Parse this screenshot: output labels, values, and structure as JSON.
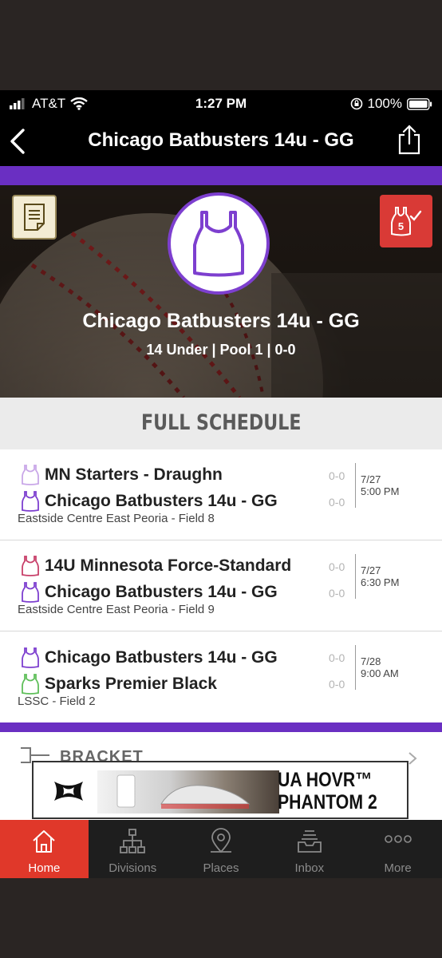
{
  "status_bar": {
    "carrier": "AT&T",
    "time": "1:27 PM",
    "battery": "100%"
  },
  "nav": {
    "title": "Chicago Batbusters 14u - GG",
    "back_icon": "chevron-left-icon",
    "share_icon": "share-icon"
  },
  "hero": {
    "team_name": "Chicago Batbusters 14u - GG",
    "subtitle": "14 Under | Pool 1 | 0-0",
    "checkin_badge": "5"
  },
  "schedule": {
    "header": "FULL SCHEDULE",
    "games": [
      {
        "team1": "MN Starters - Draughn",
        "team1_color": "#c9a7e8",
        "score1": "0-0",
        "team2": "Chicago Batbusters 14u - GG",
        "team2_color": "#7d3fcf",
        "score2": "0-0",
        "location": "Eastside Centre East Peoria - Field 8",
        "date": "7/27",
        "time": "5:00 PM"
      },
      {
        "team1": "14U Minnesota Force-Standard",
        "team1_color": "#c8406a",
        "score1": "0-0",
        "team2": "Chicago Batbusters 14u - GG",
        "team2_color": "#7d3fcf",
        "score2": "0-0",
        "location": "Eastside Centre East Peoria - Field 9",
        "date": "7/27",
        "time": "6:30 PM"
      },
      {
        "team1": "Chicago Batbusters 14u - GG",
        "team1_color": "#7d3fcf",
        "score1": "0-0",
        "team2": "Sparks Premier Black",
        "team2_color": "#5fbf5a",
        "score2": "0-0",
        "location": "LSSC - Field 2",
        "date": "7/28",
        "time": "9:00 AM"
      }
    ]
  },
  "bracket": {
    "label": "BRACKET"
  },
  "ad": {
    "line1": "UA HOVR™",
    "line2": "PHANTOM 2"
  },
  "tabs": [
    {
      "label": "Home",
      "icon": "home-icon"
    },
    {
      "label": "Divisions",
      "icon": "org-chart-icon"
    },
    {
      "label": "Places",
      "icon": "map-pin-icon"
    },
    {
      "label": "Inbox",
      "icon": "inbox-icon"
    },
    {
      "label": "More",
      "icon": "more-dots-icon"
    }
  ],
  "colors": {
    "accent_purple": "#6a2fc2",
    "active_tab": "#e0382a",
    "checkin_red": "#d93a36"
  }
}
